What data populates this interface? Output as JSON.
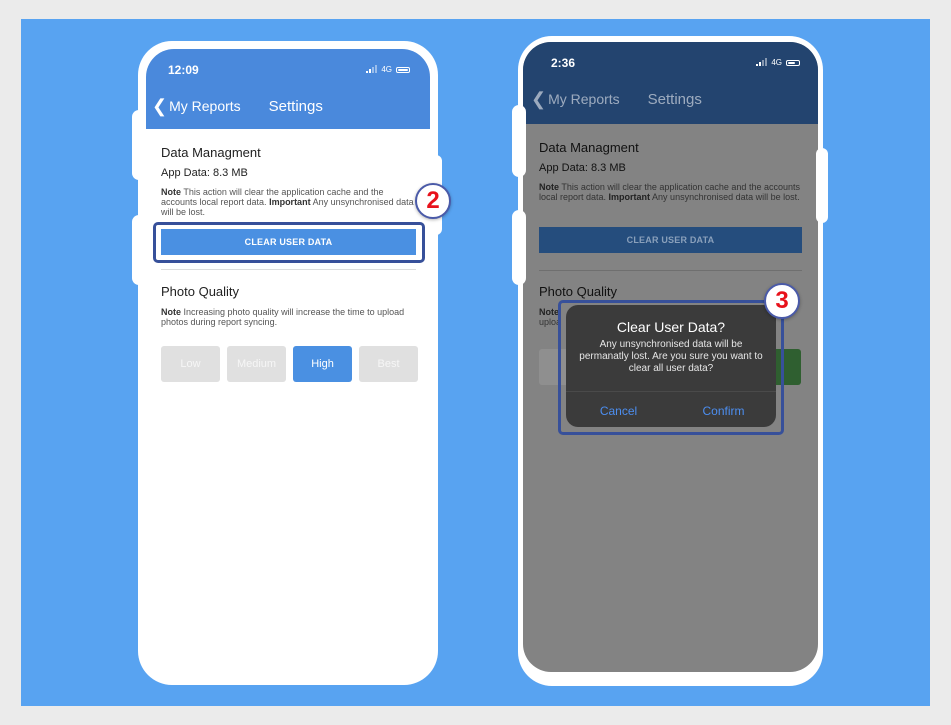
{
  "colors": {
    "canvas_bg": "#58a3f1",
    "header_blue": "#4a89dc",
    "header_blue_dimmed": "#23446f",
    "accent": "#4a90e2",
    "highlight_border": "#37509a",
    "badge_number": "#e8121b"
  },
  "left_phone": {
    "status": {
      "time": "12:09",
      "network": "4G"
    },
    "nav": {
      "back_label": "My Reports",
      "title": "Settings"
    },
    "data_management": {
      "title": "Data Managment",
      "app_data": "App Data: 8.3 MB",
      "note_bold": "Note",
      "note_text": " This action will clear the application cache and the accounts local report data. ",
      "important_bold": "Important",
      "important_text": " Any unsynchronised data will be lost.",
      "clear_button": "CLEAR USER DATA"
    },
    "photo_quality": {
      "title": "Photo Quality",
      "note_bold": "Note",
      "note_text": " Increasing photo quality will increase the time to upload photos during report syncing.",
      "options": [
        "Low",
        "Medium",
        "High",
        "Best"
      ],
      "selected": "High"
    },
    "step_badge": "2"
  },
  "right_phone": {
    "status": {
      "time": "2:36",
      "network": "4G"
    },
    "nav": {
      "back_label": "My Reports",
      "title": "Settings"
    },
    "data_management": {
      "title": "Data Managment",
      "app_data": "App Data: 8.3 MB",
      "note_bold": "Note",
      "note_text": " This action will clear the application cache and the accounts local report data. ",
      "important_bold": "Important",
      "important_text": " Any unsynchronised data will be lost.",
      "clear_button": "CLEAR USER DATA"
    },
    "photo_quality": {
      "title": "Photo Quality",
      "note_partial_1": "Note",
      "note_partial_2": "uploa"
    },
    "dialog": {
      "title": "Clear User Data?",
      "message": "Any unsynchronised data will be permanatly lost. Are you sure you want to clear all user data?",
      "cancel": "Cancel",
      "confirm": "Confirm"
    },
    "step_badge": "3"
  }
}
